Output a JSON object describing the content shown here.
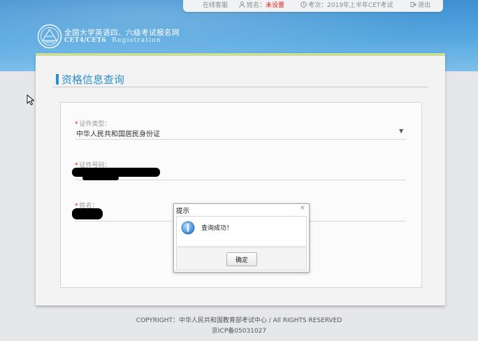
{
  "topbar": {
    "online_service": "在线客服",
    "name_label": "姓名：",
    "name_value": "未设置",
    "exam_label": "考次：",
    "exam_value": "2019年上半年CET考试",
    "logout": "退出"
  },
  "header": {
    "site_name": "全国大学英语四、六级考试报名网",
    "site_sub_main": "CET4/CET6",
    "site_sub_tail": "Registration",
    "logo_text": "NEEA"
  },
  "panel": {
    "title": "资格信息查询"
  },
  "form": {
    "required_mark": "*",
    "id_type_label": "证件类型：",
    "id_type_value": "中华人民共和国居民身份证",
    "id_number_label": "证件号码：",
    "name_label": "姓名："
  },
  "dialog": {
    "title": "提示",
    "close": "×",
    "message": "查询成功！",
    "confirm": "确定"
  },
  "footer": {
    "copyright": "COPYRIGHT：中华人民共和国教育部考试中心 / All RIGHTS RESERVED",
    "icp": "京ICP备05031027"
  },
  "colors": {
    "accent": "#2f8fd3",
    "required": "#e2231a",
    "header_top": "#3d8fd0",
    "panel_border": "#c9de97"
  }
}
